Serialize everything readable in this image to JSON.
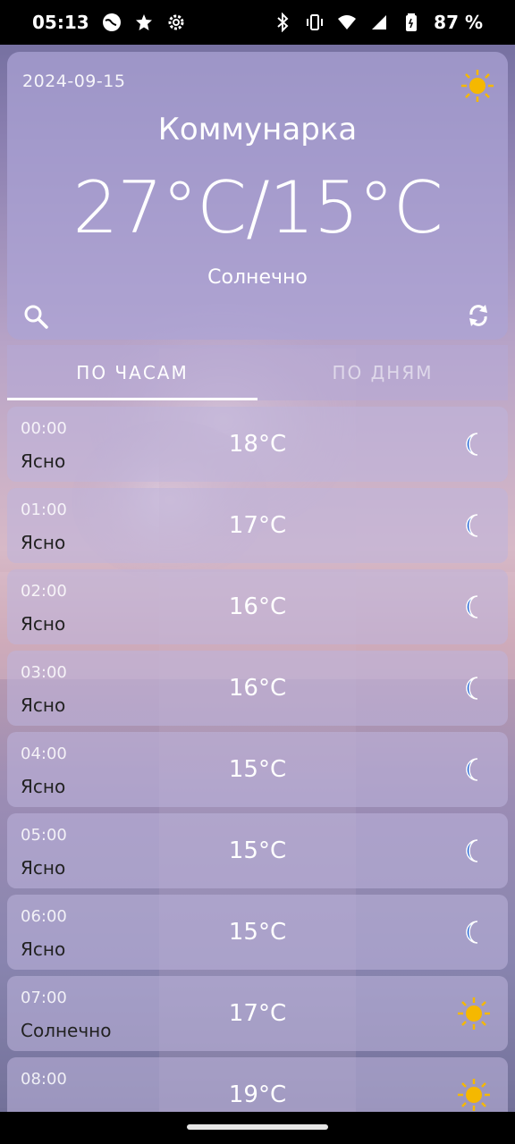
{
  "status_bar": {
    "time": "05:13",
    "battery": "87 %"
  },
  "current": {
    "date": "2024-09-15",
    "city": "Коммунарка",
    "temp": "27°C/15°C",
    "condition": "Солнечно"
  },
  "tabs": [
    {
      "label": "ПО ЧАСАМ"
    },
    {
      "label": "ПО ДНЯМ"
    }
  ],
  "hourly": [
    {
      "time": "00:00",
      "temp": "18°C",
      "desc": "Ясно",
      "icon": "moon-icon"
    },
    {
      "time": "01:00",
      "temp": "17°C",
      "desc": "Ясно",
      "icon": "moon-icon"
    },
    {
      "time": "02:00",
      "temp": "16°C",
      "desc": "Ясно",
      "icon": "moon-icon"
    },
    {
      "time": "03:00",
      "temp": "16°C",
      "desc": "Ясно",
      "icon": "moon-icon"
    },
    {
      "time": "04:00",
      "temp": "15°C",
      "desc": "Ясно",
      "icon": "moon-icon"
    },
    {
      "time": "05:00",
      "temp": "15°C",
      "desc": "Ясно",
      "icon": "moon-icon"
    },
    {
      "time": "06:00",
      "temp": "15°C",
      "desc": "Ясно",
      "icon": "moon-icon"
    },
    {
      "time": "07:00",
      "temp": "17°C",
      "desc": "Солнечно",
      "icon": "sun-icon"
    },
    {
      "time": "08:00",
      "temp": "19°C",
      "desc": "",
      "icon": "sun-icon"
    }
  ],
  "colors": {
    "sun": "#f5b800",
    "moon": "#1e63d6"
  }
}
